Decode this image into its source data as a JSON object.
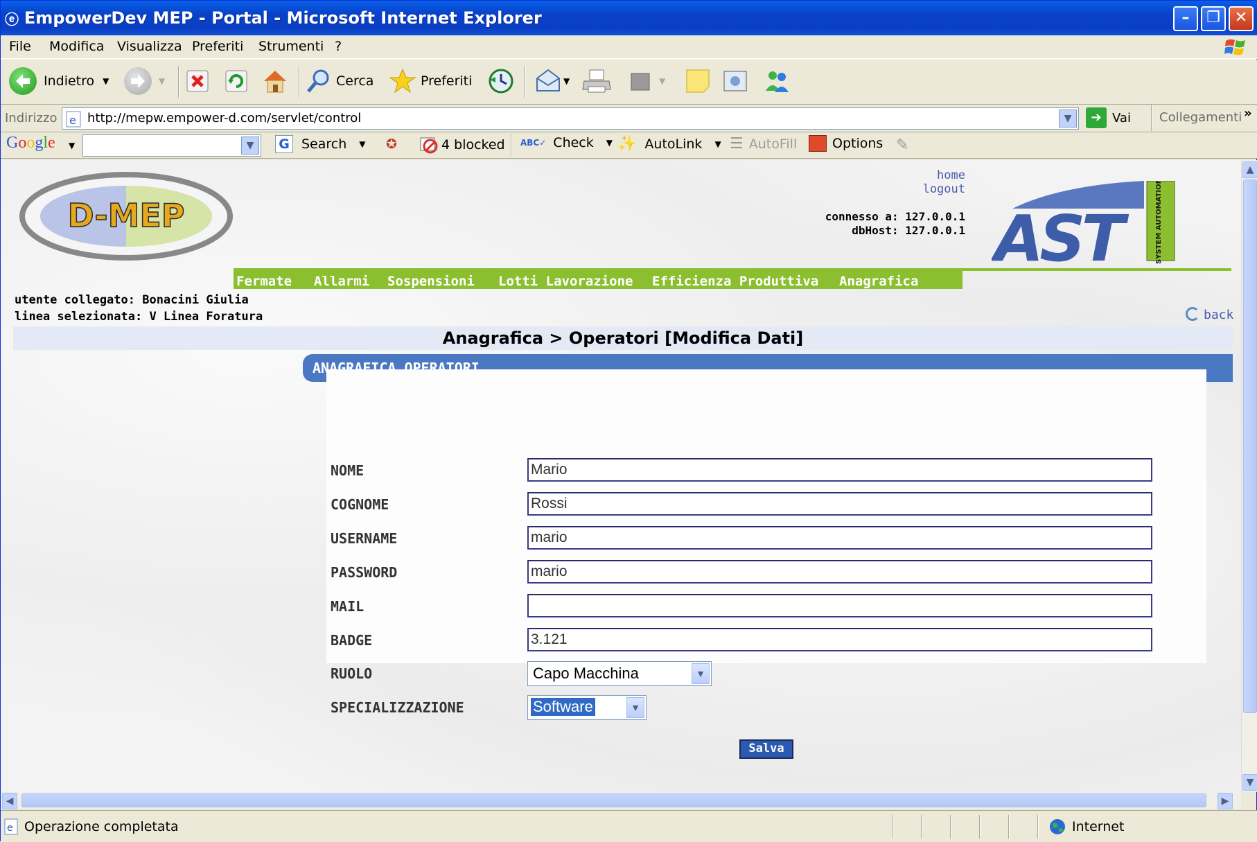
{
  "window": {
    "title": "EmpowerDev MEP - Portal - Microsoft Internet Explorer"
  },
  "menu": [
    "File",
    "Modifica",
    "Visualizza",
    "Preferiti",
    "Strumenti",
    "?"
  ],
  "toolbar": {
    "back": "Indietro",
    "search": "Cerca",
    "favorites": "Preferiti"
  },
  "address": {
    "label": "Indirizzo",
    "url": "http://mepw.empower-d.com/servlet/control",
    "go": "Vai",
    "links": "Collegamenti"
  },
  "google_bar": {
    "logo": "Google",
    "search": "Search",
    "blocked": "4 blocked",
    "check": "Check",
    "autolink": "AutoLink",
    "autofill": "AutoFill",
    "options": "Options"
  },
  "page": {
    "logo_text": "D-MEP",
    "brand_logo": "AST",
    "brand_tag": "SYSTEM AUTOMATION",
    "links": {
      "home": "home",
      "logout": "logout"
    },
    "connection": {
      "connesso": "connesso a: 127.0.0.1",
      "dbhost": "dbHost: 127.0.0.1"
    },
    "nav": [
      {
        "label": "Fermate",
        "active": false
      },
      {
        "label": "Allarmi",
        "active": false
      },
      {
        "label": "Sospensioni",
        "active": false
      },
      {
        "label": "Lotti Lavorazione",
        "active": false
      },
      {
        "label": "Efficienza Produttiva",
        "active": false
      },
      {
        "label": "Anagrafica",
        "active": true
      }
    ],
    "user": "utente collegato: Bonacini Giulia",
    "line": "linea selezionata: V Linea Foratura",
    "back": "back",
    "heading": "Anagrafica > Operatori [Modifica Dati]",
    "section": "ANAGRAFICA OPERATORI",
    "form": {
      "nome": {
        "label": "NOME",
        "value": "Mario"
      },
      "cognome": {
        "label": "COGNOME",
        "value": "Rossi"
      },
      "username": {
        "label": "USERNAME",
        "value": "mario"
      },
      "password": {
        "label": "PASSWORD",
        "value": "mario"
      },
      "mail": {
        "label": "MAIL",
        "value": ""
      },
      "badge": {
        "label": "BADGE",
        "value": "3.121"
      },
      "ruolo": {
        "label": "RUOLO",
        "value": "Capo Macchina"
      },
      "specializzazione": {
        "label": "SPECIALIZZAZIONE",
        "value": "Software"
      }
    },
    "save": "Salva"
  },
  "status": {
    "text": "Operazione completata",
    "zone": "Internet"
  },
  "colors": {
    "nav_green": "#8cbf2f",
    "section_blue": "#4a78c2",
    "title_blue": "#0a47d0",
    "link_blue": "#4a5cab"
  }
}
